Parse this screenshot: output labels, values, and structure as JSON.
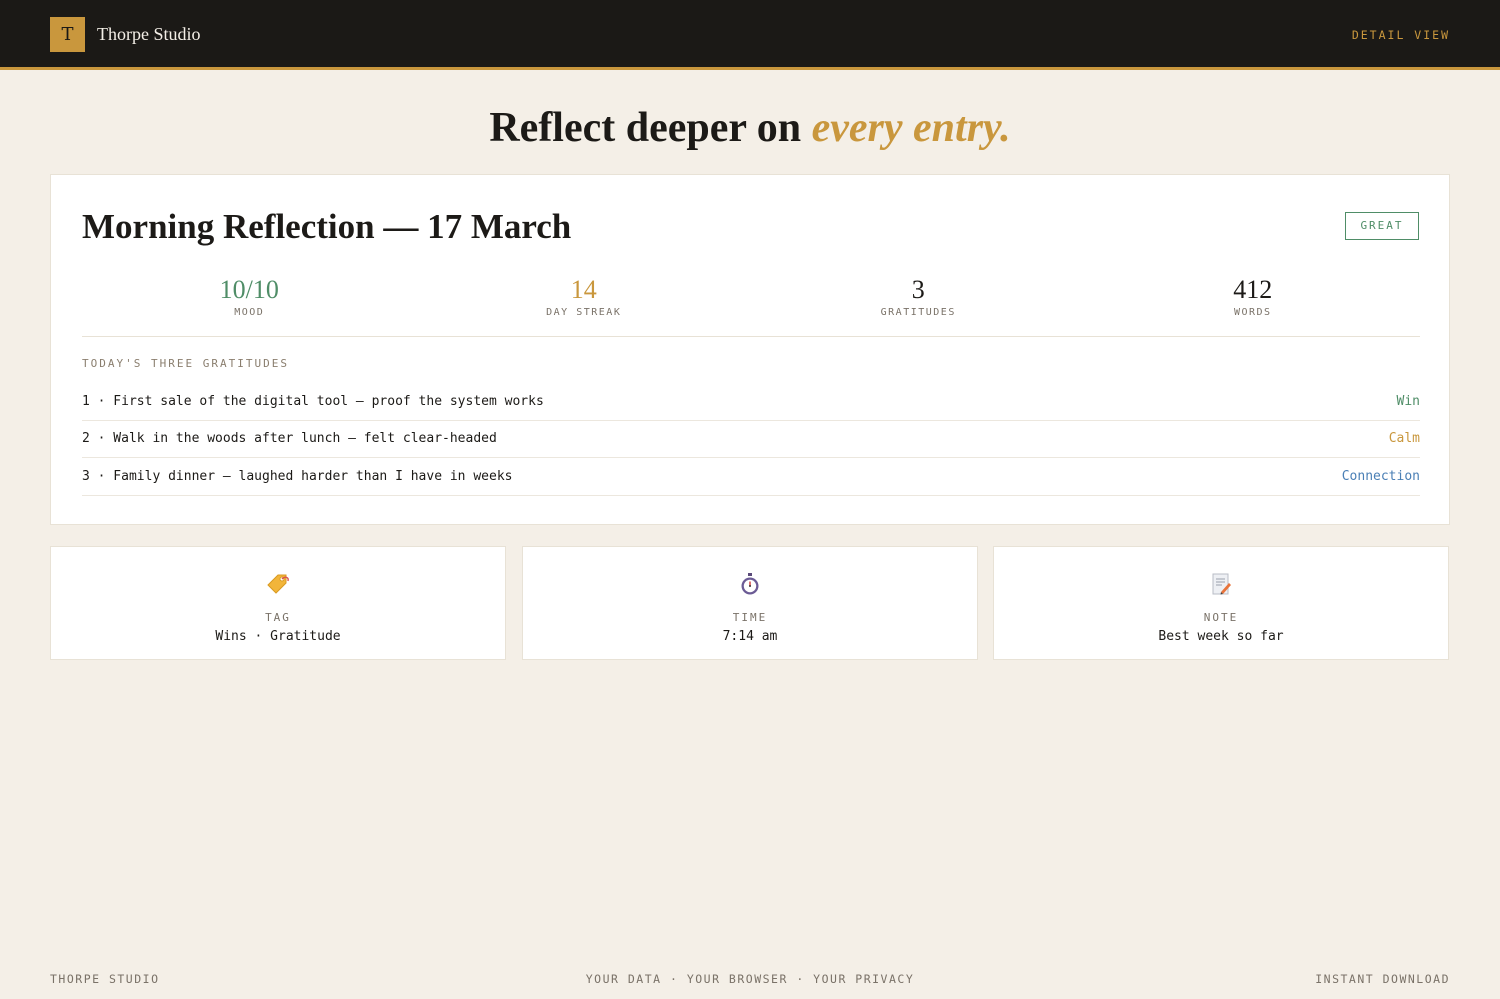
{
  "header": {
    "logo_letter": "T",
    "brand": "Thorpe Studio",
    "detail_view": "DETAIL VIEW"
  },
  "hero": {
    "lead": "Reflect deeper on ",
    "emphasis": "every entry."
  },
  "entry": {
    "title": "Morning Reflection — 17 March",
    "badge": "GREAT",
    "stats": [
      {
        "value": "10/10",
        "label": "MOOD",
        "color": "#4f8d67"
      },
      {
        "value": "14",
        "label": "DAY STREAK",
        "color": "#c9973d"
      },
      {
        "value": "3",
        "label": "GRATITUDES",
        "color": "#1c1a17"
      },
      {
        "value": "412",
        "label": "WORDS",
        "color": "#1c1a17"
      }
    ],
    "gratitudes_label": "TODAY'S THREE GRATITUDES",
    "gratitudes": [
      {
        "text": "1 · First sale of the digital tool — proof the system works",
        "tag": "Win",
        "color": "#4f8d67"
      },
      {
        "text": "2 · Walk in the woods after lunch — felt clear-headed",
        "tag": "Calm",
        "color": "#c9973d"
      },
      {
        "text": "3 · Family dinner — laughed harder than I have in weeks",
        "tag": "Connection",
        "color": "#4a7fb5"
      }
    ]
  },
  "info_cards": [
    {
      "icon": "tag-icon",
      "label": "TAG",
      "value": "Wins · Gratitude"
    },
    {
      "icon": "stopwatch-icon",
      "label": "TIME",
      "value": "7:14 am"
    },
    {
      "icon": "memo-icon",
      "label": "NOTE",
      "value": "Best week so far"
    }
  ],
  "footer": {
    "left": "THORPE STUDIO",
    "center": "YOUR DATA · YOUR BROWSER · YOUR PRIVACY",
    "right": "INSTANT DOWNLOAD"
  },
  "colors": {
    "accent": "#c9973d",
    "green": "#4f8d67",
    "blue": "#4a7fb5",
    "header_bg": "#1b1916",
    "page_bg": "#f4efe7"
  }
}
